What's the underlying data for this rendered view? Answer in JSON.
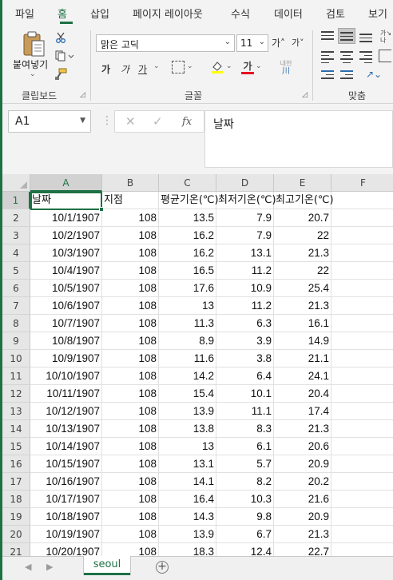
{
  "ribbon": {
    "tabs": [
      "파일",
      "홈",
      "삽입",
      "페이지 레이아웃",
      "수식",
      "데이터",
      "검토",
      "보기"
    ],
    "active_tab": "홈",
    "paste_label": "붙여넣기",
    "clipboard_label": "클립보드",
    "font_label": "글꼴",
    "alignment_label": "맞춤",
    "font_name": "맑은 고딕",
    "font_size": "11",
    "grow_font": "가˄",
    "shrink_font": "가˅",
    "bold": "가",
    "italic": "가",
    "underline": "가",
    "font_color_glyph": "가",
    "phonetic": "내천",
    "phonetic_sub": "川",
    "font_color": "#e81123",
    "highlight_color": "#ffff00",
    "accent_color": "#1e7145"
  },
  "formula_bar": {
    "name_box": "A1",
    "cancel_glyph": "✕",
    "enter_glyph": "✓",
    "fx_glyph": "fx",
    "formula": "날짜"
  },
  "grid": {
    "columns": [
      "A",
      "B",
      "C",
      "D",
      "E",
      "F"
    ],
    "selected_cell": "A1",
    "header_row": [
      "날짜",
      "지점",
      "평균기온(℃)",
      "최저기온(℃)",
      "최고기온(℃)"
    ],
    "rows": [
      [
        "10/1/1907",
        "108",
        "13.5",
        "7.9",
        "20.7"
      ],
      [
        "10/2/1907",
        "108",
        "16.2",
        "7.9",
        "22"
      ],
      [
        "10/3/1907",
        "108",
        "16.2",
        "13.1",
        "21.3"
      ],
      [
        "10/4/1907",
        "108",
        "16.5",
        "11.2",
        "22"
      ],
      [
        "10/5/1907",
        "108",
        "17.6",
        "10.9",
        "25.4"
      ],
      [
        "10/6/1907",
        "108",
        "13",
        "11.2",
        "21.3"
      ],
      [
        "10/7/1907",
        "108",
        "11.3",
        "6.3",
        "16.1"
      ],
      [
        "10/8/1907",
        "108",
        "8.9",
        "3.9",
        "14.9"
      ],
      [
        "10/9/1907",
        "108",
        "11.6",
        "3.8",
        "21.1"
      ],
      [
        "10/10/1907",
        "108",
        "14.2",
        "6.4",
        "24.1"
      ],
      [
        "10/11/1907",
        "108",
        "15.4",
        "10.1",
        "20.4"
      ],
      [
        "10/12/1907",
        "108",
        "13.9",
        "11.1",
        "17.4"
      ],
      [
        "10/13/1907",
        "108",
        "13.8",
        "8.3",
        "21.3"
      ],
      [
        "10/14/1907",
        "108",
        "13",
        "6.1",
        "20.6"
      ],
      [
        "10/15/1907",
        "108",
        "13.1",
        "5.7",
        "20.9"
      ],
      [
        "10/16/1907",
        "108",
        "14.1",
        "8.2",
        "20.2"
      ],
      [
        "10/17/1907",
        "108",
        "16.4",
        "10.3",
        "21.6"
      ],
      [
        "10/18/1907",
        "108",
        "14.3",
        "9.8",
        "20.9"
      ],
      [
        "10/19/1907",
        "108",
        "13.9",
        "6.7",
        "21.3"
      ],
      [
        "10/20/1907",
        "108",
        "18.3",
        "12.4",
        "22.7"
      ]
    ]
  },
  "sheets": {
    "tabs": [
      "seoul"
    ],
    "active": "seoul",
    "add_glyph": "+"
  }
}
